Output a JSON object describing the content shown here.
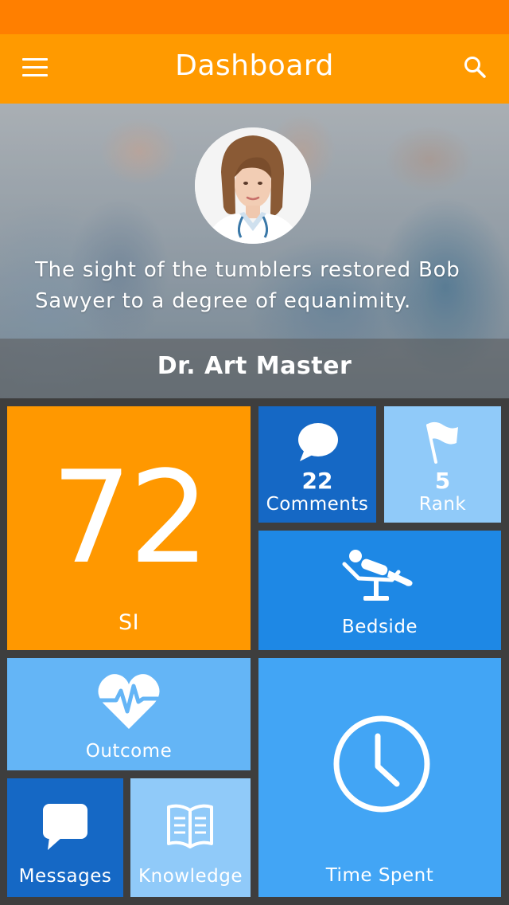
{
  "header": {
    "title": "Dashboard"
  },
  "icons": {
    "menu": "hamburger-icon",
    "search": "search-icon"
  },
  "colors": {
    "status_bar": "#ff7f00",
    "app_bar": "#ff9a00",
    "tile_orange": "#ff9800",
    "tile_dark_blue": "#1568c5",
    "tile_light_blue": "#90caf9",
    "tile_blue": "#1e88e5",
    "background": "#3e3e3e"
  },
  "profile": {
    "quote": "The sight of the tumblers restored Bob Sawyer to a degree of equanimity.",
    "name": "Dr. Art Master"
  },
  "tiles": {
    "si": {
      "value": "72",
      "label": "SI"
    },
    "comments": {
      "value": "22",
      "label": "Comments",
      "icon": "speech-bubble-icon"
    },
    "rank": {
      "value": "5",
      "label": "Rank",
      "icon": "flag-icon"
    },
    "bedside": {
      "label": "Bedside",
      "icon": "patient-bed-icon"
    },
    "outcome": {
      "label": "Outcome",
      "icon": "heart-pulse-icon"
    },
    "time_spent": {
      "label": "Time Spent",
      "icon": "clock-icon"
    },
    "messages": {
      "label": "Messages",
      "icon": "message-icon"
    },
    "knowledge": {
      "label": "Knowledge",
      "icon": "book-icon"
    }
  }
}
